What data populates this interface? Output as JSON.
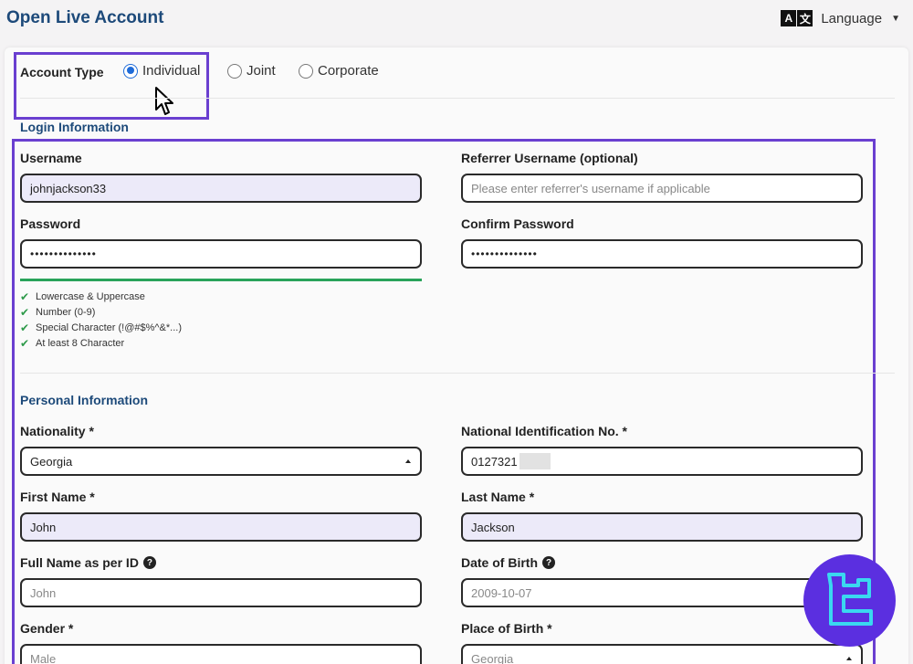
{
  "page": {
    "title": "Open Live Account"
  },
  "language": {
    "icon": "translate-icon",
    "label": "Language"
  },
  "account_type": {
    "label": "Account Type",
    "options": [
      {
        "label": "Individual",
        "selected": true
      },
      {
        "label": "Joint",
        "selected": false
      },
      {
        "label": "Corporate",
        "selected": false
      }
    ]
  },
  "login": {
    "title": "Login Information",
    "username": {
      "label": "Username",
      "value": "johnjackson33"
    },
    "referrer": {
      "label": "Referrer Username (optional)",
      "placeholder": "Please enter referrer's username if applicable"
    },
    "password": {
      "label": "Password",
      "value": "••••••••••••••"
    },
    "confirm_password": {
      "label": "Confirm Password",
      "value": "••••••••••••••"
    },
    "rules": [
      "Lowercase & Uppercase",
      "Number (0-9)",
      "Special Character (!@#$%^&*...)",
      "At least 8 Character"
    ]
  },
  "personal": {
    "title": "Personal Information",
    "nationality": {
      "label": "Nationality *",
      "value": "Georgia"
    },
    "national_id": {
      "label": "National Identification No. *",
      "value": "0127321"
    },
    "first_name": {
      "label": "First Name *",
      "value": "John"
    },
    "last_name": {
      "label": "Last Name *",
      "value": "Jackson"
    },
    "full_name": {
      "label": "Full Name as per ID",
      "value": "John"
    },
    "dob": {
      "label": "Date of Birth",
      "value": "2009-10-07"
    },
    "gender": {
      "label": "Gender *",
      "value": "Male"
    },
    "place_of_birth": {
      "label": "Place of Birth *",
      "value": "Georgia"
    }
  },
  "colors": {
    "accent": "#1d4a7a",
    "highlight_border": "#6a3fd0",
    "check": "#2e9a4a",
    "radio": "#1e6bd8",
    "logo_bg": "#5b2fe0",
    "logo_fg": "#3ad8f0"
  }
}
